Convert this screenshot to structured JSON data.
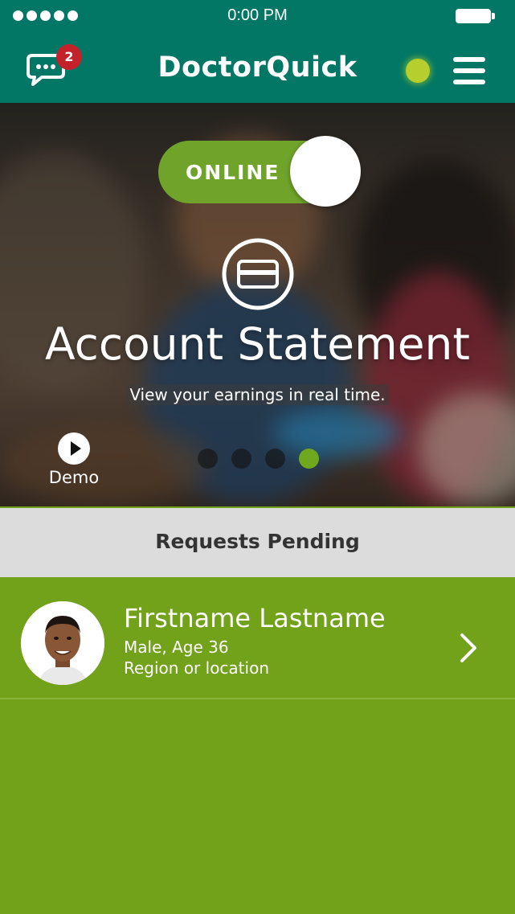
{
  "status_bar": {
    "time": "0:00 PM"
  },
  "header": {
    "title": "DoctorQuick",
    "messages_badge": "2",
    "status_dot_color": "#b7cf2d",
    "icons": [
      "chat-icon",
      "menu-icon"
    ]
  },
  "hero": {
    "toggle_label": "ONLINE",
    "icon": "credit-card-icon",
    "title": "Account Statement",
    "subtitle": "View your earnings in real time.",
    "demo_label": "Demo",
    "carousel": {
      "count": 4,
      "active_index": 4
    }
  },
  "requests": {
    "header": "Requests Pending",
    "items": [
      {
        "name": "Firstname Lastname",
        "gender_age": "Male, Age 36",
        "location": "Region or location"
      }
    ]
  },
  "colors": {
    "header_bg": "#027765",
    "accent_green": "#72a11a",
    "toggle_green": "#6fa32a",
    "badge_red": "#c4222b",
    "pending_bar_bg": "#dcdcdc"
  }
}
